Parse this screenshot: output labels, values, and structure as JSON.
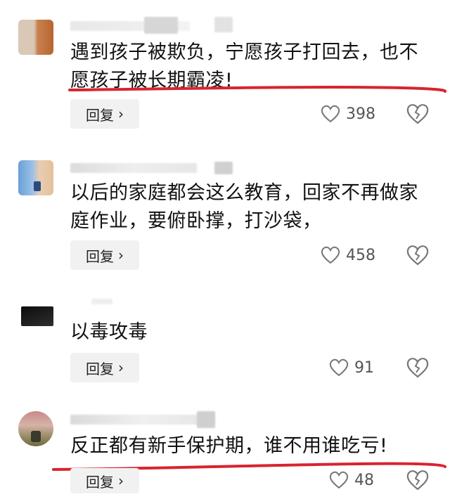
{
  "comments": [
    {
      "text": "遇到孩子被欺负，宁愿孩子打回去，也不愿孩子被长期霸凌!",
      "reply_label": "回复",
      "like_count": "398",
      "avatar_colors": [
        "#c8814f",
        "#d1b9a1"
      ]
    },
    {
      "text": "以后的家庭都会这么教育，回家不再做家庭作业，要俯卧撑，打沙袋，",
      "reply_label": "回复",
      "like_count": "458",
      "avatar_colors": [
        "#6aa0d8",
        "#e9cdb0"
      ]
    },
    {
      "text": "以毒攻毒",
      "reply_label": "回复",
      "like_count": "91",
      "avatar_colors": [
        "#111111",
        "#3a3a3a"
      ]
    },
    {
      "text": "反正都有新手保护期，谁不用谁吃亏!",
      "reply_label": "回复",
      "like_count": "48",
      "avatar_colors": [
        "#c79a8e",
        "#8b7b55"
      ]
    }
  ],
  "colors": {
    "underline": "#d8242f",
    "icon_stroke": "#777777",
    "reply_bg": "#f1f1f1"
  },
  "icons": {
    "like": "heart-outline-icon",
    "dislike": "broken-heart-icon",
    "chevron": "chevron-right-icon"
  }
}
